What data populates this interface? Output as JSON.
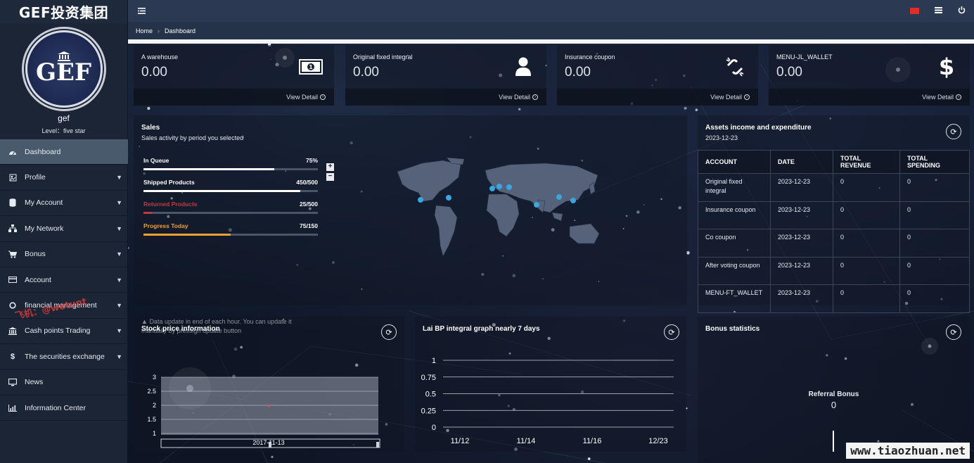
{
  "app": {
    "brand": "GEF投资集团",
    "logo_text": "GEF"
  },
  "user": {
    "name": "gef",
    "level": "Level：five star"
  },
  "sidebar": {
    "items": [
      {
        "label": "Dashboard",
        "icon": "dashboard-icon"
      },
      {
        "label": "Profile",
        "icon": "profile-icon"
      },
      {
        "label": "My Account",
        "icon": "database-icon"
      },
      {
        "label": "My Network",
        "icon": "network-icon"
      },
      {
        "label": "Bonus",
        "icon": "cart-icon"
      },
      {
        "label": "Account",
        "icon": "credit-card-icon"
      },
      {
        "label": "financial management",
        "icon": "circle-icon"
      },
      {
        "label": "Cash points Trading",
        "icon": "bank-icon"
      },
      {
        "label": "The securities exchange",
        "icon": "dollar-icon"
      },
      {
        "label": "News",
        "icon": "monitor-icon"
      },
      {
        "label": "Information Center",
        "icon": "bar-chart-icon"
      }
    ]
  },
  "watermark_overlay": "飞机：@wetunt",
  "breadcrumb": {
    "home": "Home",
    "current": "Dashboard"
  },
  "stats": [
    {
      "label": "A warehouse",
      "value": "0.00",
      "link": "View Detail",
      "icon": "money-icon"
    },
    {
      "label": "Original fixed integral",
      "value": "0.00",
      "link": "View Detail",
      "icon": "user-icon"
    },
    {
      "label": "Insurance coupon",
      "value": "0.00",
      "link": "View Detail",
      "icon": "unlink-icon"
    },
    {
      "label": "MENU-JL_WALLET",
      "value": "0.00",
      "link": "View Detail",
      "icon": "dollar-icon"
    }
  ],
  "sales": {
    "title": "Sales",
    "subtitle": "Sales activity by period you selected",
    "progress": [
      {
        "label": "In Queue",
        "value_text": "75%",
        "fraction": 0.75,
        "label_color": "#ffffff",
        "bar_color": "#ffffff"
      },
      {
        "label": "Shipped Products",
        "value_text": "450/500",
        "fraction": 0.9,
        "label_color": "#ffffff",
        "bar_color": "#ffffff"
      },
      {
        "label": "Returned Products",
        "value_text": "25/500",
        "fraction": 0.05,
        "label_color": "#c0393f",
        "bar_color": "#c0393f"
      },
      {
        "label": "Progress Today",
        "value_text": "75/150",
        "fraction": 0.5,
        "label_color": "#f0a030",
        "bar_color": "#f0a030"
      }
    ],
    "note": "Data update in end of each hour. You can update it manually by pressign update button"
  },
  "assets": {
    "title": "Assets income and expenditure",
    "date": "2023-12-23",
    "headers": [
      "ACCOUNT",
      "DATE",
      "TOTAL REVENUE",
      "TOTAL SPENDING"
    ],
    "rows": [
      {
        "account": "Original fixed integral",
        "date": "2023-12-23",
        "revenue": "0",
        "spending": "0"
      },
      {
        "account": "Insurance coupon",
        "date": "2023-12-23",
        "revenue": "0",
        "spending": "0"
      },
      {
        "account": "Co coupon",
        "date": "2023-12-23",
        "revenue": "0",
        "spending": "0"
      },
      {
        "account": "After voting coupon",
        "date": "2023-12-23",
        "revenue": "0",
        "spending": "0"
      },
      {
        "account": "MENU-FT_WALLET",
        "date": "2023-12-23",
        "revenue": "0",
        "spending": "0"
      }
    ]
  },
  "stock": {
    "title": "Stock price information",
    "y_ticks": [
      "3",
      "2.5",
      "2",
      "1.5",
      "1"
    ],
    "x_label": "2017-11-13"
  },
  "lai_chart": {
    "title": "Lai BP integral graph nearly 7 days",
    "chart_data": {
      "type": "line",
      "x": [
        "11/12",
        "11/14",
        "11/16",
        "12/23"
      ],
      "y_ticks": [
        "1",
        "0.75",
        "0.5",
        "0.25",
        "0"
      ],
      "ylim": [
        0,
        1
      ]
    }
  },
  "bonus": {
    "title": "Bonus statistics",
    "label": "Referral Bonus",
    "value": "0"
  },
  "site_watermark": "www.tiaozhuan.net",
  "colors": {
    "accent_active": "#4a5a6d",
    "revenue": "#76c35a",
    "spending": "#d9454a",
    "map_dot": "#3aa6e0"
  }
}
